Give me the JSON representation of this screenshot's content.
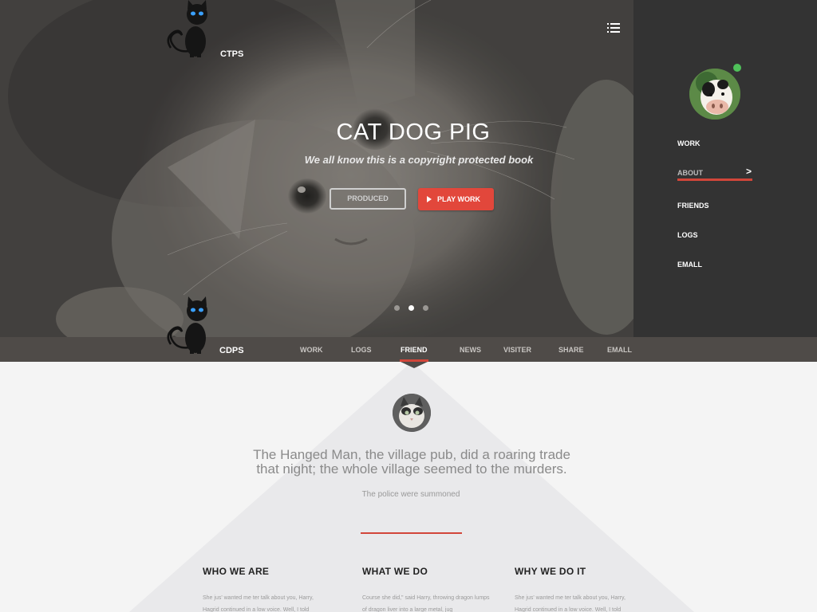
{
  "header": {
    "brand_top": "CTPS",
    "menu_icon": "hamburger-list-icon"
  },
  "hero": {
    "title": "CAT DOG PIG",
    "subtitle": "We all know this is a copyright protected book",
    "btn_produced": "PRODUCED",
    "btn_play": "PLAY WORK",
    "slides": 3,
    "active_slide": 2
  },
  "side_menu": {
    "items": [
      {
        "label": "WORK"
      },
      {
        "label": "ABOUT"
      },
      {
        "label": "FRIENDS"
      },
      {
        "label": "LOGS"
      },
      {
        "label": "EMALL"
      }
    ],
    "active_index": 1,
    "chevron": ">"
  },
  "navbar": {
    "brand": "CDPS",
    "items": [
      {
        "label": "WORK"
      },
      {
        "label": "LOGS"
      },
      {
        "label": "FRIEND"
      },
      {
        "label": "NEWS"
      },
      {
        "label": "VISITER"
      },
      {
        "label": "SHARE"
      },
      {
        "label": "EMALL"
      }
    ],
    "active_index": 2
  },
  "content": {
    "quote_line1": "The Hanged Man, the village pub, did a roaring trade",
    "quote_line2": "that night; the whole village  seemed to the murders.",
    "quote_sub": "The police were summoned",
    "columns": [
      {
        "title": "WHO WE ARE",
        "text": "She jus' wanted me ter talk about you, Harry, Hagrid continued in a low voice. Well, I told"
      },
      {
        "title": "WHAT WE DO",
        "text": "Course she did,\" said Harry, throwing dragon lumps of dragon liver into a large metal, jug"
      },
      {
        "title": "WHY WE DO IT",
        "text": "She jus' wanted me ter talk about you, Harry, Hagrid continued in a low voice. Well, I told"
      }
    ]
  },
  "colors": {
    "accent": "#e2473b",
    "side_panel": "#333333",
    "navbar": "#4f4b48",
    "online": "#4fc15a"
  }
}
